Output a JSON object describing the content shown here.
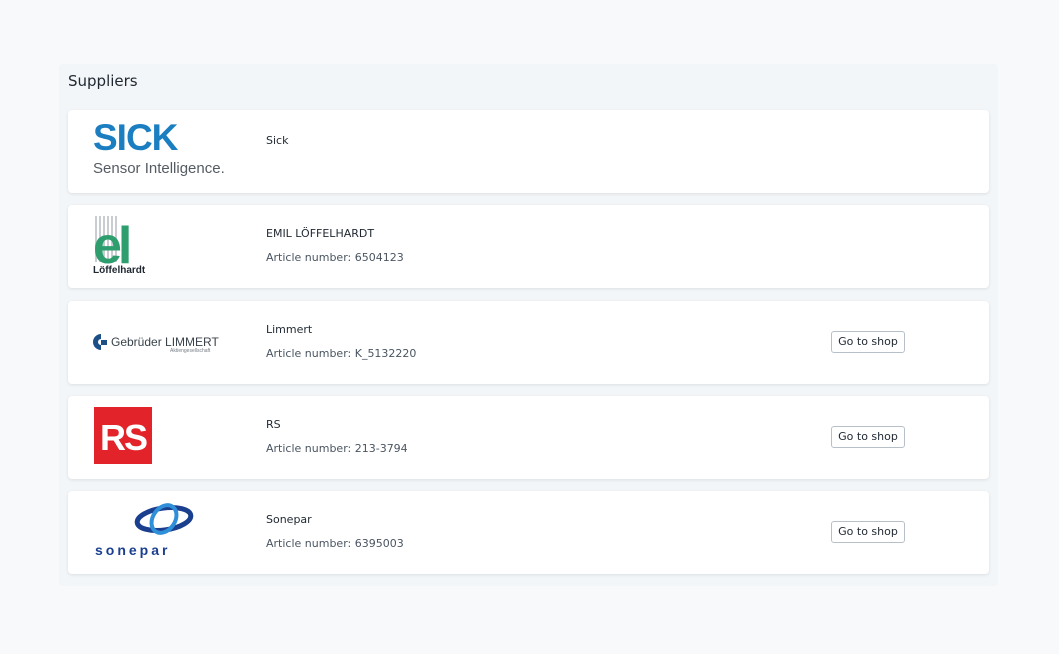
{
  "section": {
    "title": "Suppliers"
  },
  "suppliers": [
    {
      "name": "Sick",
      "logo": {
        "brand": "SICK",
        "tagline": "Sensor Intelligence.",
        "color": "#1a7ec1"
      }
    },
    {
      "name": "EMIL LÖFFELHARDT",
      "article": "Article number: 6504123",
      "logo": {
        "brand": "el",
        "tagline": "Löffelhardt",
        "color": "#2e9e6f"
      }
    },
    {
      "name": "Limmert",
      "article": "Article number: K_5132220",
      "button": "Go to shop",
      "logo": {
        "brand": "Gebrüder LIMMERT",
        "tagline": "Aktiengesellschaft",
        "color": "#1c4f87"
      }
    },
    {
      "name": "RS",
      "article": "Article number: 213-3794",
      "button": "Go to shop",
      "logo": {
        "brand": "RS",
        "color": "#e2232a"
      }
    },
    {
      "name": "Sonepar",
      "article": "Article number: 6395003",
      "button": "Go to shop",
      "logo": {
        "brand": "sonepar",
        "color": "#1b3f8f"
      }
    }
  ]
}
